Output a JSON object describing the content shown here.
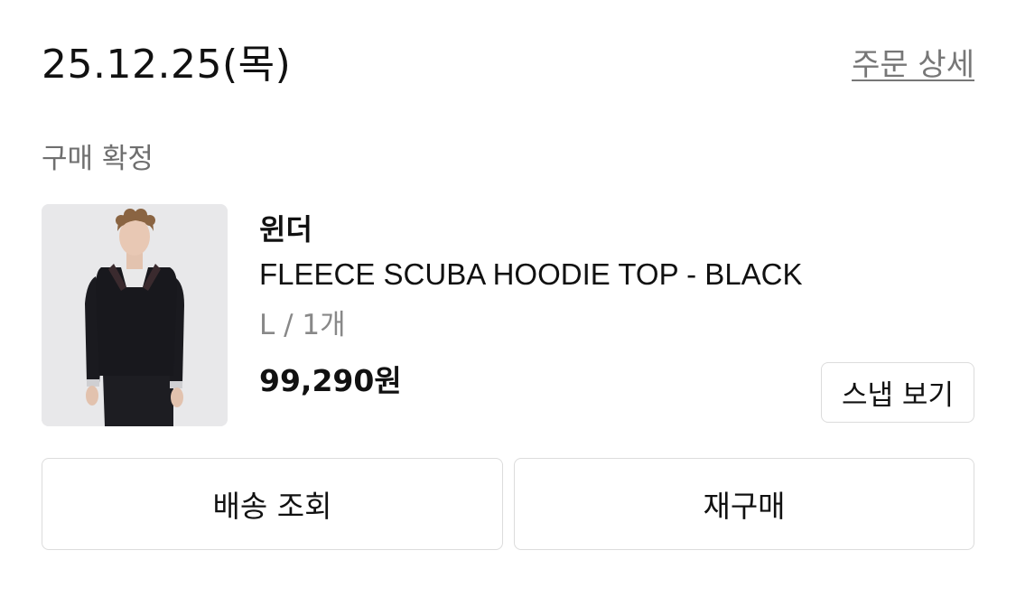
{
  "order": {
    "date": "25.12.25(목)",
    "detail_link": "주문 상세",
    "status": "구매 확정"
  },
  "product": {
    "image_icon": "product-photo-model-wearing-black-fleece-hoodie",
    "brand": "윈더",
    "name": "FLEECE SCUBA HOODIE TOP - BLACK",
    "option": "L / 1개",
    "price": "99,290원"
  },
  "buttons": {
    "snap": "스냅 보기",
    "tracking": "배송 조회",
    "rebuy": "재구매"
  },
  "colors": {
    "text_primary": "#111111",
    "text_secondary": "#777777",
    "border": "#dcdcdc",
    "background": "#ffffff"
  }
}
